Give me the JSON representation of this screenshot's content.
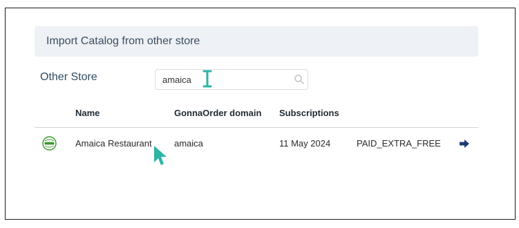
{
  "header": {
    "title": "Import Catalog from other store"
  },
  "search": {
    "label": "Other Store",
    "value": "amaica"
  },
  "table": {
    "columns": {
      "name": "Name",
      "domain": "GonnaOrder domain",
      "subscriptions": "Subscriptions"
    },
    "rows": [
      {
        "name": "Amaica Restaurant",
        "domain": "amaica",
        "subscription_date": "11 May 2024",
        "plan": "PAID_EXTRA_FREE",
        "logo_text": "Amaica Restaurant"
      }
    ]
  },
  "colors": {
    "accent": "#3a4d63",
    "arrow": "#1e3a74",
    "cursor": "#2bb5a6",
    "logo": "#3c9a2d"
  }
}
